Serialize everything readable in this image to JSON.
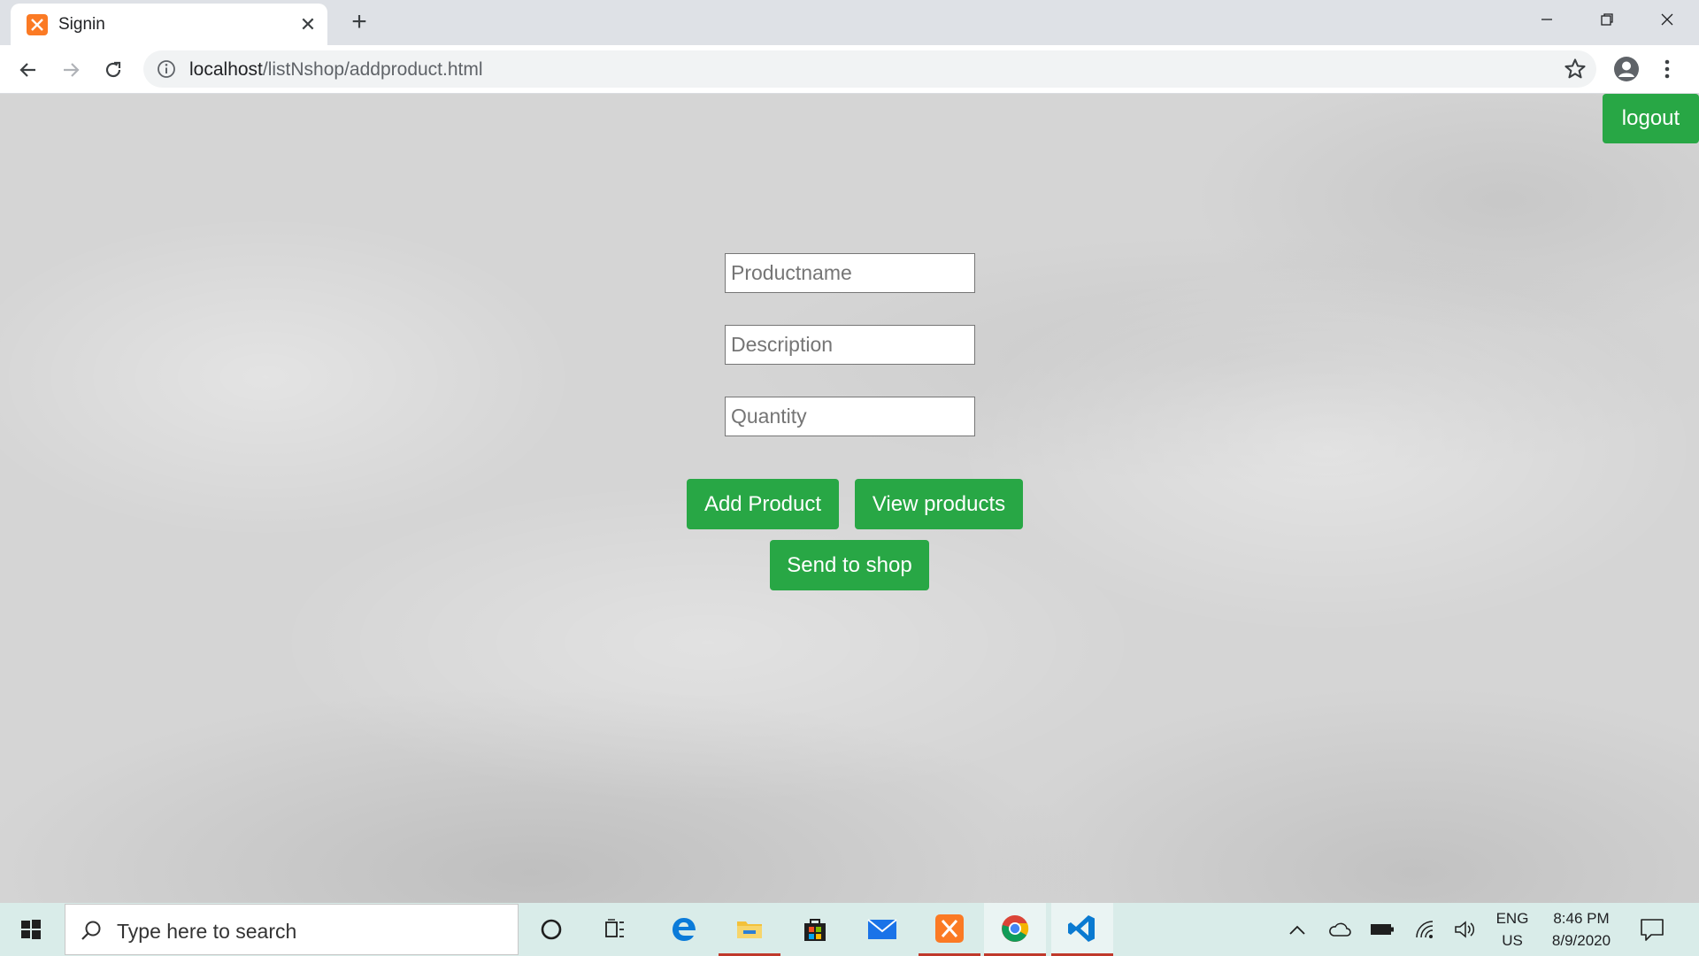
{
  "browser": {
    "tab_title": "Signin",
    "url_host": "localhost",
    "url_path": "/listNshop/addproduct.html"
  },
  "page": {
    "logout_label": "logout",
    "product_name_placeholder": "Productname",
    "description_placeholder": "Description",
    "quantity_placeholder": "Quantity",
    "add_product_label": "Add Product",
    "view_products_label": "View products",
    "send_to_shop_label": "Send to shop",
    "accent_color": "#28a745"
  },
  "taskbar": {
    "search_placeholder": "Type here to search",
    "language": "ENG",
    "region": "US",
    "time": "8:46 PM",
    "date": "8/9/2020",
    "pinned_icons": [
      "cortana-icon",
      "task-view-icon",
      "edge-icon",
      "file-explorer-icon",
      "store-icon",
      "mail-icon",
      "xampp-icon",
      "chrome-icon",
      "vscode-icon"
    ]
  }
}
